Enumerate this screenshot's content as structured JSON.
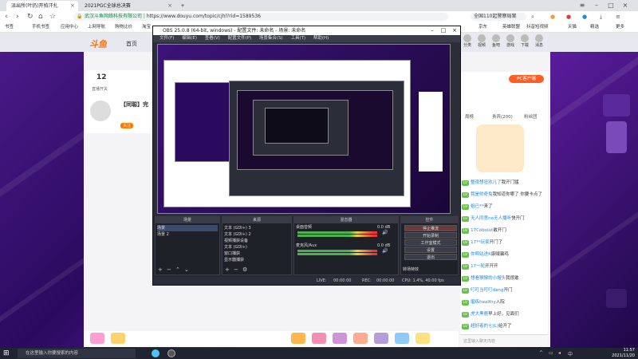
{
  "browser": {
    "tabs": [
      {
        "label": "派出所(叶扔)开拍汗扎",
        "active": true
      },
      {
        "label": "2021PGC全球总决赛",
        "active": false
      }
    ],
    "new_tab": "+",
    "url": "https://www.douyu.com/topic/cjhl?rid=1589536",
    "url_prefix": "武汉斗鱼网络科技有限公司 |",
    "search_value": "全国110起警察局案",
    "bookmarks": [
      "书签",
      "手机书签",
      "应用中心",
      "上网导航",
      "购物比价",
      "淘宝",
      "京东",
      "英雄联盟",
      "抖音短视频",
      "天猫",
      "精选"
    ],
    "bookmarks_right": [
      "更多"
    ]
  },
  "douyu": {
    "logo": "斗鱼",
    "home": "首页",
    "header_icons": [
      "分类",
      "视频",
      "鱼吧",
      "游戏",
      "下载",
      "消息"
    ],
    "room_count": "12",
    "room_tab": "直播开关",
    "streamer_title": "【同聪】完",
    "streamer_follow": "关注",
    "pc_button": "PC客户端",
    "chat_tabs": [
      "周榜",
      "贵宾(200)",
      "粉丝团"
    ],
    "chat_messages": [
      {
        "badge": "LV",
        "name": "整夜想狂欢儿了",
        "text": "我开门猛"
      },
      {
        "badge": "LV",
        "name": "我是帅奇兔",
        "text": "我知道你哪了 你要卡点了"
      },
      {
        "badge": "LV",
        "name": "姐已**",
        "text": "来了"
      },
      {
        "badge": "LV",
        "name": "无人同意no无人播听",
        "text": "快开门"
      },
      {
        "badge": "LV",
        "name": "17Cobolut",
        "text": "敢开门"
      },
      {
        "badge": "LV",
        "name": "17**玩家",
        "text": "开门了"
      },
      {
        "badge": "LV",
        "name": "你明站进K",
        "text": "康贼骗鸡"
      },
      {
        "badge": "LV",
        "name": "17一轮",
        "text": "开开开"
      },
      {
        "badge": "LV",
        "name": "想看猴猴的小帽头",
        "text": "我很敢"
      },
      {
        "badge": "LV",
        "name": "叮叮当叮叮dang",
        "text": "开门"
      },
      {
        "badge": "LV",
        "name": "磨练healthy",
        "text": "入院"
      },
      {
        "badge": "LV",
        "name": "虎大黑鹿",
        "text": "早上好，见面们"
      },
      {
        "badge": "LV",
        "name": "超好者的七(L)",
        "text": "给开了"
      }
    ],
    "chat_input_placeholder": "这里输入聊天内容"
  },
  "obs": {
    "title": "OBS 25.0.8 (64-bit, windows) - 配置文件: 未命名 - 场景: 未命名",
    "menu": [
      "文件(F)",
      "编辑(E)",
      "查看(V)",
      "配置文件(P)",
      "场景集合(S)",
      "工具(T)",
      "帮助(H)"
    ],
    "docks": {
      "scenes_title": "场景",
      "sources_title": "来源",
      "mixer_title": "混音器",
      "controls_title": "控件",
      "transitions_title": "转场特效"
    },
    "scenes": [
      "场景",
      "场景 2"
    ],
    "sources": [
      "文本 (GDI+) 3",
      "文本 (GDI+) 2",
      "视频捕获设备",
      "文本 (GDI+)",
      "窗口捕获",
      "显示器捕获"
    ],
    "mixer": [
      {
        "name": "桌面音频",
        "db": "0.0 dB"
      },
      {
        "name": "麦克风/Aux",
        "db": "0.0 dB"
      }
    ],
    "controls": [
      "停止推流",
      "开始录制",
      "工作室模式",
      "设置",
      "退出"
    ],
    "status": {
      "lost": "LIVE:",
      "live_time": "00:00:00",
      "rec": "REC:",
      "rec_time": "00:00:00",
      "cpu": "CPU: 1.4%, 40.00 fps"
    }
  },
  "taskbar": {
    "search_placeholder": "在这里输入你要搜索的内容",
    "time": "11:57",
    "date": "2021/11/20"
  }
}
